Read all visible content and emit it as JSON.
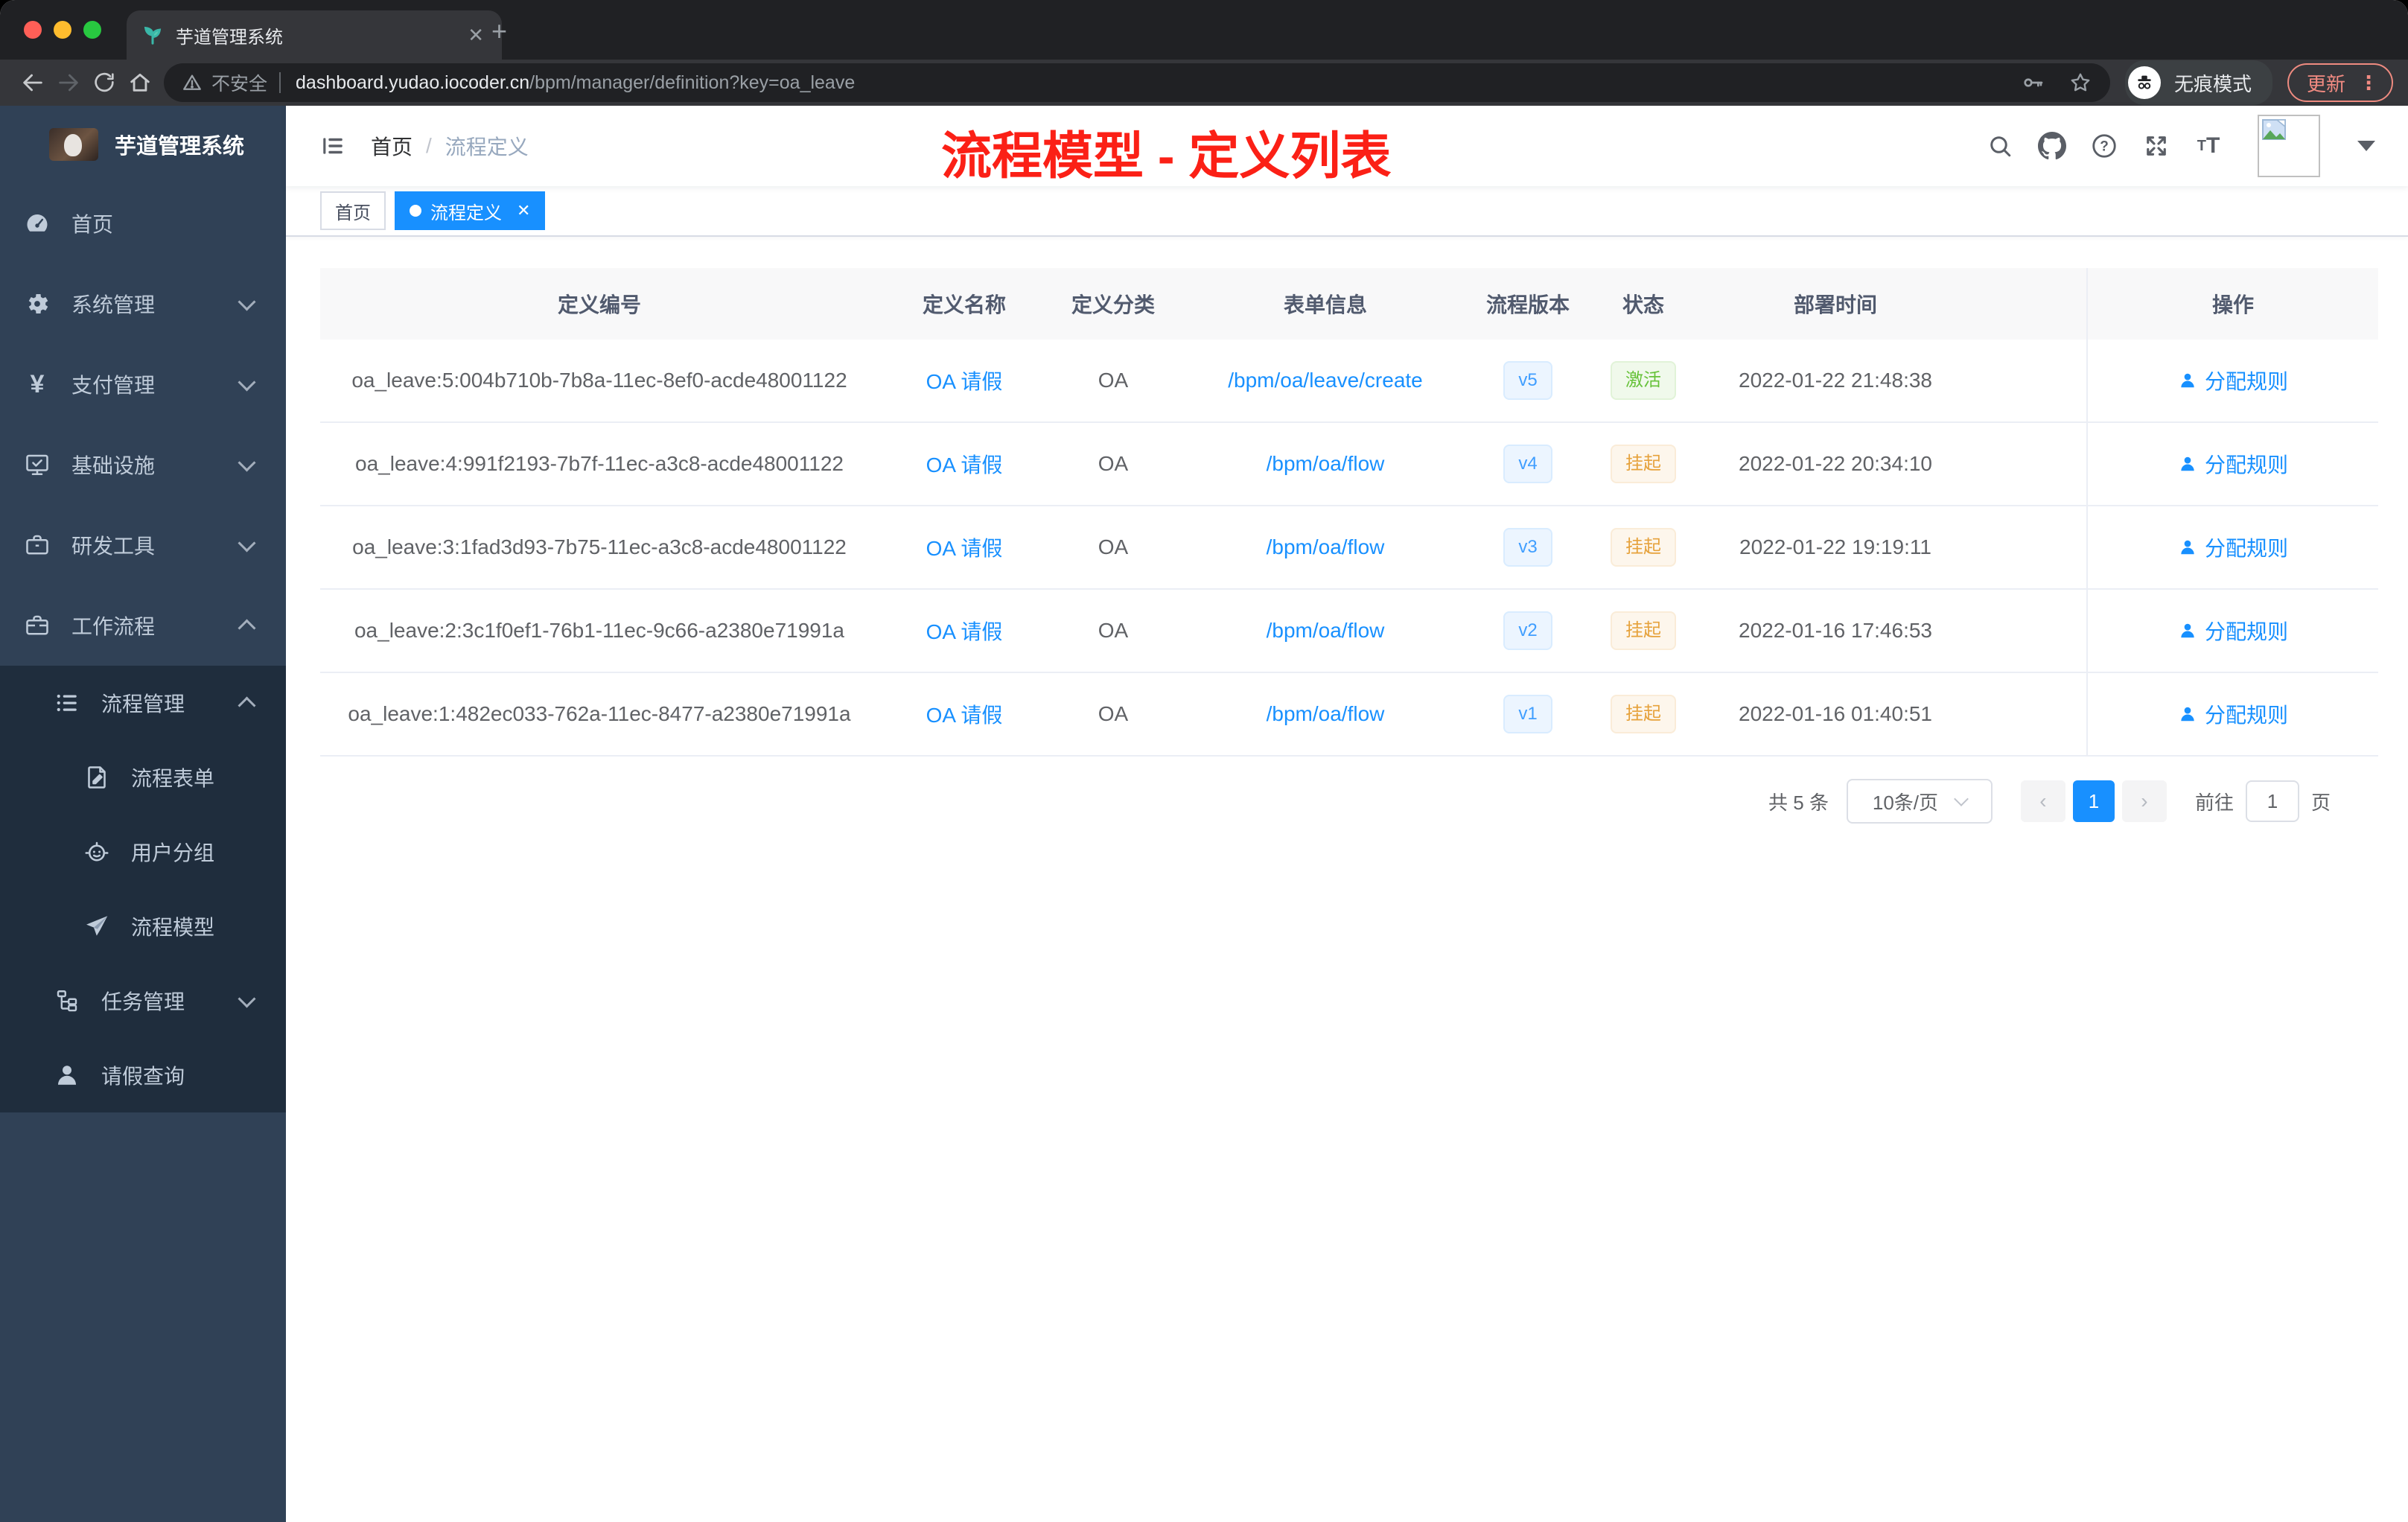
{
  "browser": {
    "tab_title": "芋道管理系统",
    "security_label": "不安全",
    "url_host": "dashboard.yudao.iocoder.cn",
    "url_path": "/bpm/manager/definition?key=oa_leave",
    "incognito_label": "无痕模式",
    "update_label": "更新"
  },
  "sidebar": {
    "logo_title": "芋道管理系统",
    "items": [
      {
        "label": "首页",
        "icon": "dashboard-icon"
      },
      {
        "label": "系统管理",
        "icon": "gear-icon",
        "state": "collapsed"
      },
      {
        "label": "支付管理",
        "icon": "yen-icon",
        "state": "collapsed"
      },
      {
        "label": "基础设施",
        "icon": "monitor-check-icon",
        "state": "collapsed"
      },
      {
        "label": "研发工具",
        "icon": "toolbox-icon",
        "state": "collapsed"
      },
      {
        "label": "工作流程",
        "icon": "briefcase-icon",
        "state": "expanded"
      },
      {
        "label": "流程管理",
        "icon": "list-tree-icon",
        "state": "expanded"
      },
      {
        "label": "流程表单",
        "icon": "form-edit-icon"
      },
      {
        "label": "用户分组",
        "icon": "robot-icon"
      },
      {
        "label": "流程模型",
        "icon": "paper-plane-icon"
      },
      {
        "label": "任务管理",
        "icon": "org-tree-icon",
        "state": "collapsed"
      },
      {
        "label": "请假查询",
        "icon": "user-icon"
      }
    ]
  },
  "header": {
    "breadcrumb": [
      "首页",
      "流程定义"
    ],
    "annotation": "流程模型 - 定义列表"
  },
  "tags": [
    {
      "label": "首页",
      "active": false
    },
    {
      "label": "流程定义",
      "active": true
    }
  ],
  "table": {
    "columns": [
      "定义编号",
      "定义名称",
      "定义分类",
      "表单信息",
      "流程版本",
      "状态",
      "部署时间",
      "操作"
    ],
    "action_label": "分配规则",
    "rows": [
      {
        "id": "oa_leave:5:004b710b-7b8a-11ec-8ef0-acde48001122",
        "name": "OA 请假",
        "category": "OA",
        "form": "/bpm/oa/leave/create",
        "version": "v5",
        "status": "激活",
        "status_type": "success",
        "deploy_time": "2022-01-22 21:48:38"
      },
      {
        "id": "oa_leave:4:991f2193-7b7f-11ec-a3c8-acde48001122",
        "name": "OA 请假",
        "category": "OA",
        "form": "/bpm/oa/flow",
        "version": "v4",
        "status": "挂起",
        "status_type": "warning",
        "deploy_time": "2022-01-22 20:34:10"
      },
      {
        "id": "oa_leave:3:1fad3d93-7b75-11ec-a3c8-acde48001122",
        "name": "OA 请假",
        "category": "OA",
        "form": "/bpm/oa/flow",
        "version": "v3",
        "status": "挂起",
        "status_type": "warning",
        "deploy_time": "2022-01-22 19:19:11"
      },
      {
        "id": "oa_leave:2:3c1f0ef1-76b1-11ec-9c66-a2380e71991a",
        "name": "OA 请假",
        "category": "OA",
        "form": "/bpm/oa/flow",
        "version": "v2",
        "status": "挂起",
        "status_type": "warning",
        "deploy_time": "2022-01-16 17:46:53"
      },
      {
        "id": "oa_leave:1:482ec033-762a-11ec-8477-a2380e71991a",
        "name": "OA 请假",
        "category": "OA",
        "form": "/bpm/oa/flow",
        "version": "v1",
        "status": "挂起",
        "status_type": "warning",
        "deploy_time": "2022-01-16 01:40:51"
      }
    ]
  },
  "pagination": {
    "total_label": "共 5 条",
    "page_size_label": "10条/页",
    "current_page": "1",
    "goto_label": "前往",
    "goto_value": "1",
    "page_unit_label": "页"
  },
  "colors": {
    "primary": "#1890ff",
    "link": "#1890ff",
    "annotation_red": "#fb2016",
    "status_active_green": "#67c23a",
    "status_suspend_orange": "#e6a23c",
    "sidebar_bg": "#304156",
    "sidebar_submenu_bg": "#1f2d3d",
    "tag_active_bg": "#1890ff"
  }
}
